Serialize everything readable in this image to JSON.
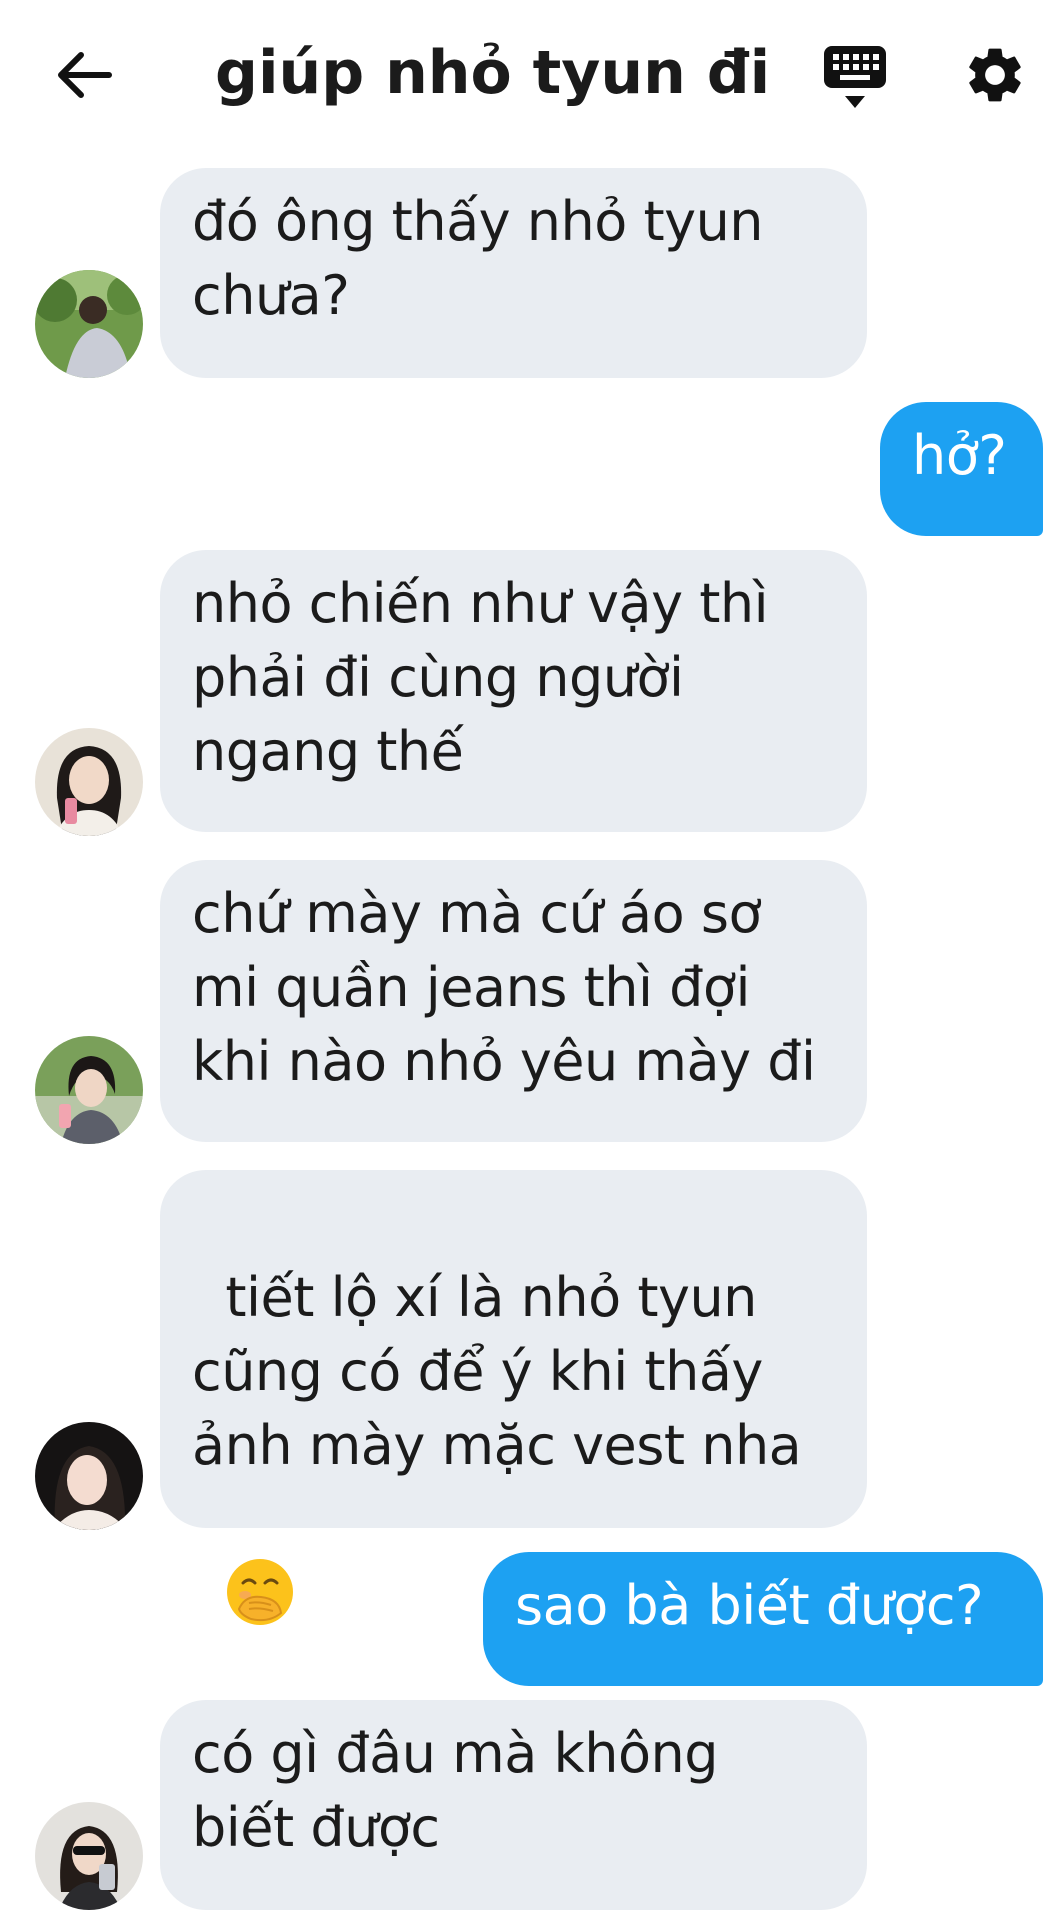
{
  "header": {
    "title": "giúp nhỏ tyun đi",
    "back_icon": "arrow-left-icon",
    "keyboard_icon": "keyboard-icon",
    "settings_icon": "gear-icon"
  },
  "colors": {
    "incoming_bubble": "#e9edf2",
    "outgoing_bubble": "#1da1f2",
    "text": "#1b1b1b"
  },
  "messages": [
    {
      "direction": "incoming",
      "text": "đó ông thấy nhỏ tyun\nchưa?"
    },
    {
      "direction": "outgoing",
      "text": "hở?"
    },
    {
      "direction": "incoming",
      "text": "nhỏ chiến như vậy thì\nphải đi cùng người\nngang thế"
    },
    {
      "direction": "incoming",
      "text": "chứ mày mà cứ áo sơ\nmi quần jeans thì đợi\nkhi nào nhỏ yêu mày đi"
    },
    {
      "direction": "incoming",
      "text": "tiết lộ xí là nhỏ tyun\ncũng có để ý khi thấy\nảnh mày mặc vest nha",
      "emoji": "face-with-hand-over-mouth"
    },
    {
      "direction": "outgoing",
      "text": "sao bà biết được?"
    },
    {
      "direction": "incoming",
      "text": "có gì đâu mà không\nbiết được"
    }
  ]
}
